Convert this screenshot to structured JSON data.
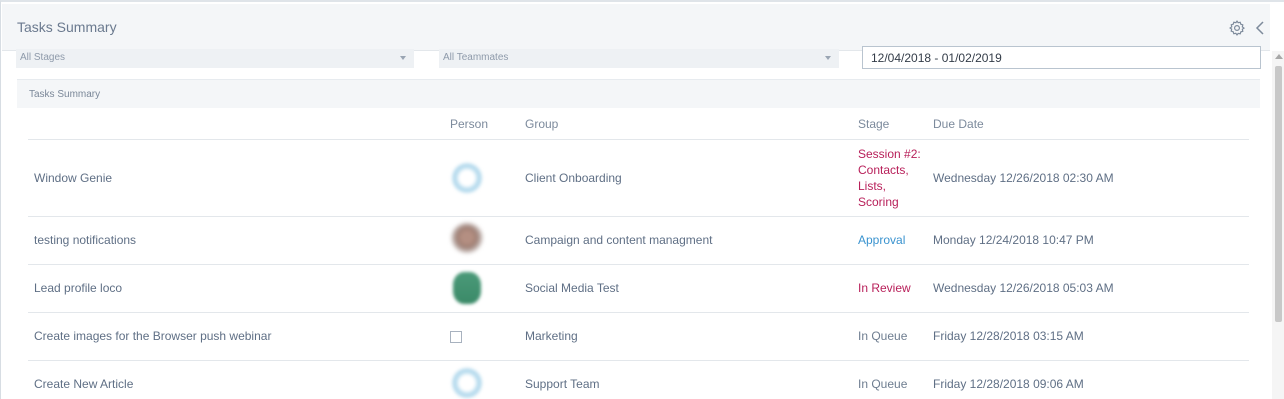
{
  "header": {
    "title": "Tasks Summary"
  },
  "filters": {
    "stages_placeholder": "All Stages",
    "teammates_placeholder": "All Teammates",
    "date_range": "12/04/2018 - 01/02/2019"
  },
  "panel": {
    "title": "Tasks Summary"
  },
  "columns": {
    "person": "Person",
    "group": "Group",
    "stage": "Stage",
    "due_date": "Due Date"
  },
  "rows": [
    {
      "task": "Window Genie",
      "person_avatar": "loading-ring",
      "group": "Client Onboarding",
      "stage": "Session #2: Contacts, Lists, Scoring",
      "stage_color": "#b8205a",
      "due": "Wednesday 12/26/2018 02:30 AM"
    },
    {
      "task": "testing notifications",
      "person_avatar": "photo",
      "group": "Campaign and content managment",
      "stage": "Approval",
      "stage_color": "#3a93cf",
      "due": "Monday 12/24/2018 10:47 PM"
    },
    {
      "task": "Lead profile loco",
      "person_avatar": "green-avatar",
      "group": "Social Media Test",
      "stage": "In Review",
      "stage_color": "#b8205a",
      "due": "Wednesday 12/26/2018 05:03 AM"
    },
    {
      "task": "Create images for the Browser push webinar",
      "person_avatar": "checkbox",
      "group": "Marketing",
      "stage": "In Queue",
      "stage_color": "#6e7d90",
      "due": "Friday 12/28/2018 03:15 AM"
    },
    {
      "task": "Create New Article",
      "person_avatar": "loading-ring",
      "group": "Support Team",
      "stage": "In Queue",
      "stage_color": "#6e7d90",
      "due": "Friday 12/28/2018 09:06 AM"
    }
  ],
  "icons": {
    "settings": "gear-icon",
    "collapse": "chevron-left-icon"
  }
}
